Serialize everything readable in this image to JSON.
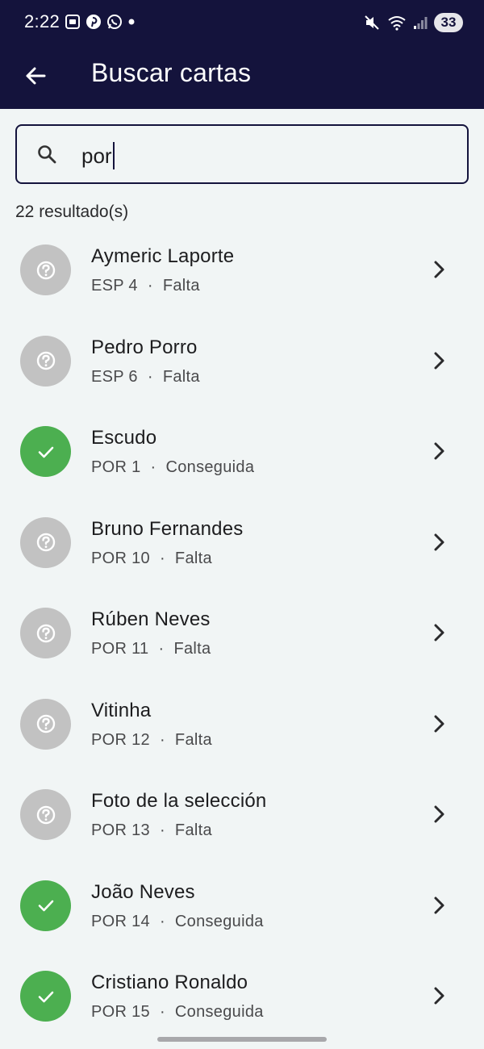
{
  "status_bar": {
    "time": "2:22",
    "battery": "33"
  },
  "app_bar": {
    "title": "Buscar cartas"
  },
  "search": {
    "value": "por"
  },
  "results_count": "22 resultado(s)",
  "colors": {
    "header": "#14133c",
    "owned": "#4caf50",
    "missing": "#c2c2c2"
  },
  "items": [
    {
      "name": "Aymeric Laporte",
      "code": "ESP 4",
      "status": "Falta",
      "owned": false
    },
    {
      "name": "Pedro Porro",
      "code": "ESP 6",
      "status": "Falta",
      "owned": false
    },
    {
      "name": "Escudo",
      "code": "POR 1",
      "status": "Conseguida",
      "owned": true
    },
    {
      "name": "Bruno Fernandes",
      "code": "POR 10",
      "status": "Falta",
      "owned": false
    },
    {
      "name": "Rúben Neves",
      "code": "POR 11",
      "status": "Falta",
      "owned": false
    },
    {
      "name": "Vitinha",
      "code": "POR 12",
      "status": "Falta",
      "owned": false
    },
    {
      "name": "Foto de la selección",
      "code": "POR 13",
      "status": "Falta",
      "owned": false
    },
    {
      "name": "João Neves",
      "code": "POR 14",
      "status": "Conseguida",
      "owned": true
    },
    {
      "name": "Cristiano Ronaldo",
      "code": "POR 15",
      "status": "Conseguida",
      "owned": true
    }
  ]
}
